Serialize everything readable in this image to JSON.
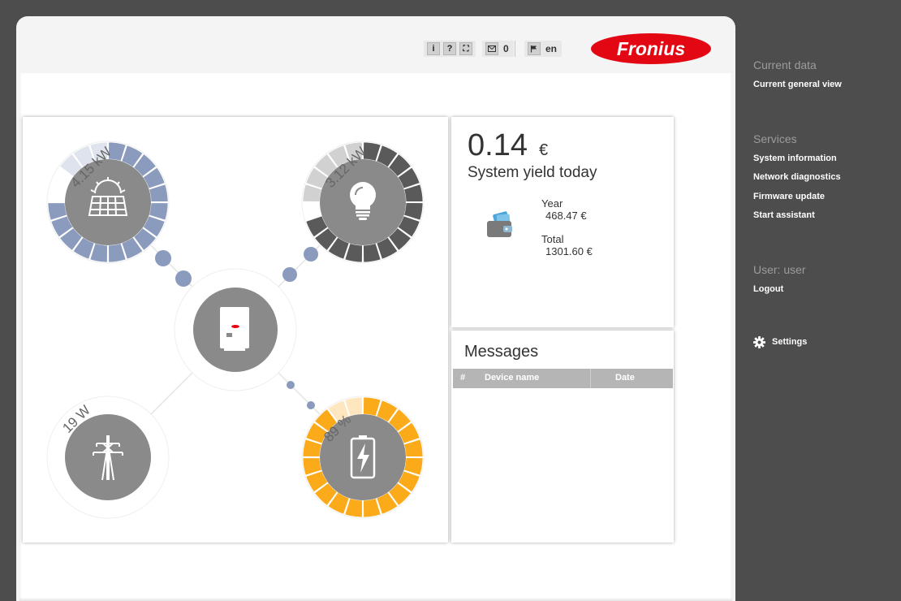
{
  "toolbar": {
    "info_label": "i",
    "help_label": "?",
    "fullscreen_label": "⛶",
    "messages_count": "0",
    "language": "en"
  },
  "brand": {
    "logo_text": "Fronius",
    "color": "#e30613"
  },
  "flow": {
    "solar": {
      "label": "4.15 kW",
      "fill_fraction": 0.74,
      "color": "#8a9bbd"
    },
    "load": {
      "label": "3.12 kW",
      "fill_fraction": 0.68,
      "color": "#5a5a5a"
    },
    "grid": {
      "label": "19 W"
    },
    "battery": {
      "label": "89 %",
      "fill_fraction": 0.89,
      "color": "#fbaa19"
    }
  },
  "yield": {
    "today_value": "0.14",
    "currency": "€",
    "today_label": "System yield today",
    "year_label": "Year",
    "year_value": "468.47 €",
    "total_label": "Total",
    "total_value": "1301.60 €"
  },
  "messages": {
    "title": "Messages",
    "columns": [
      "#",
      "Device name",
      "Date"
    ]
  },
  "sidebar": {
    "sections": [
      {
        "heading": "Current data",
        "items": [
          "Current general view"
        ]
      },
      {
        "heading": "Services",
        "items": [
          "System information",
          "Network diagnostics",
          "Firmware update",
          "Start assistant"
        ]
      },
      {
        "heading": "User: user",
        "items": [
          "Logout"
        ]
      }
    ],
    "settings_label": "Settings"
  }
}
